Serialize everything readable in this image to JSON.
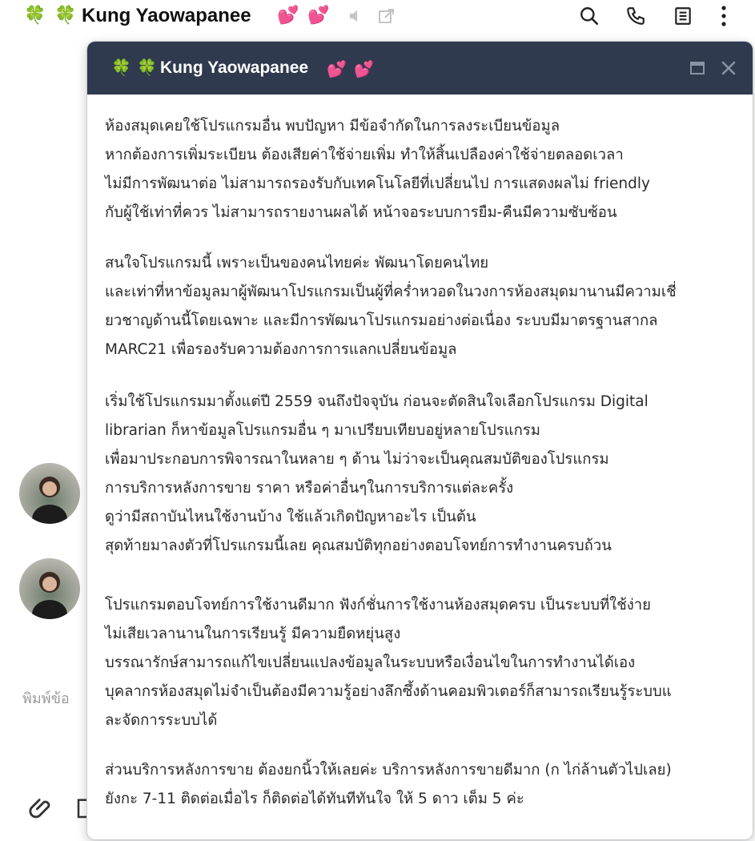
{
  "header": {
    "title": "Kung Yaowapanee",
    "clover_glyph": "🍀",
    "heart_glyph": "💕",
    "icons": [
      "speaker-icon",
      "popout-icon",
      "search-icon",
      "phone-icon",
      "notes-icon",
      "more-icon"
    ]
  },
  "input": {
    "placeholder_partial": "พิมพ์ข้อ"
  },
  "popup": {
    "title": "Kung Yaowapanee",
    "paragraphs": [
      [
        "ห้องสมุดเคยใช้โปรแกรมอื่น พบปัญหา มีข้อจำกัดในการลงระเบียนข้อมูล",
        "หากต้องการเพิ่มระเบียน ต้องเสียค่าใช้จ่ายเพิ่ม ทำให้สิ้นเปลืองค่าใช้จ่ายตลอดเวลา",
        "ไม่มีการพัฒนาต่อ ไม่สามารถรองรับกับเทคโนโลยีที่เปลี่ยนไป การแสดงผลไม่ friendly",
        "กับผู้ใช้เท่าที่ควร ไม่สามารถรายงานผลได้ หน้าจอระบบการยืม-คืนมีความซับซ้อน"
      ],
      [
        "สนใจโปรแกรมนี้ เพราะเป็นของคนไทยค่ะ พัฒนาโดยคนไทย",
        "และเท่าที่หาข้อมูลมาผู้พัฒนาโปรแกรมเป็นผู้ที่คร่ำหวอดในวงการห้องสมุดมานานมีความเชี่",
        "ยวชาญด้านนี้โดยเฉพาะ และมีการพัฒนาโปรแกรมอย่างต่อเนื่อง ระบบมีมาตรฐานสากล",
        "MARC21 เพื่อรองรับความต้องการการแลกเปลี่ยนข้อมูล"
      ],
      [
        "เริ่มใช้โปรแกรมมาตั้งแต่ปี 2559 จนถึงปัจจุบัน ก่อนจะตัดสินใจเลือกโปรแกรม Digital",
        "librarian ก็หาข้อมูลโปรแกรมอื่น ๆ มาเปรียบเทียบอยู่หลายโปรแกรม",
        "เพื่อมาประกอบการพิจารณาในหลาย ๆ ด้าน ไม่ว่าจะเป็นคุณสมบัติของโปรแกรม",
        "การบริการหลังการขาย ราคา หรือค่าอื่นๆในการบริการแต่ละครั้ง",
        "ดูว่ามีสถาบันไหนใช้งานบ้าง ใช้แล้วเกิดปัญหาอะไร เป็นต้น",
        "สุดท้ายมาลงตัวที่โปรแกรมนี้เลย คุณสมบัติทุกอย่างตอบโจทย์การทำงานครบถ้วน"
      ],
      [
        "โปรแกรมตอบโจทย์การใช้งานดีมาก ฟังก์ชั่นการใช้งานห้องสมุดครบ เป็นระบบที่ใช้ง่าย",
        "ไม่เสียเวลานานในการเรียนรู้ มีความยืดหยุ่นสูง",
        "บรรณารักษ์สามารถแก้ไขเปลี่ยนแปลงข้อมูลในระบบหรือเงื่อนไขในการทำงานได้เอง",
        "บุคลากรห้องสมุดไม่จำเป็นต้องมีความรู้อย่างลึกซึ้งด้านคอมพิวเตอร์ก็สามารถเรียนรู้ระบบแ",
        "ละจัดการระบบได้"
      ],
      [
        "ส่วนบริการหลังการขาย ต้องยกนิ้วให้เลยค่ะ บริการหลังการขายดีมาก (ก ไก่ล้านตัวไปเลย)",
        "ยังกะ 7-11 ติดต่อเมื่อไร ก็ติดต่อได้ทันทีทันใจ ให้ 5 ดาว เต็ม 5 ค่ะ"
      ]
    ]
  },
  "colors": {
    "popup_header_bg": "#2f3a4f",
    "clover": "#1ea84b",
    "heart": "#e8447a"
  }
}
